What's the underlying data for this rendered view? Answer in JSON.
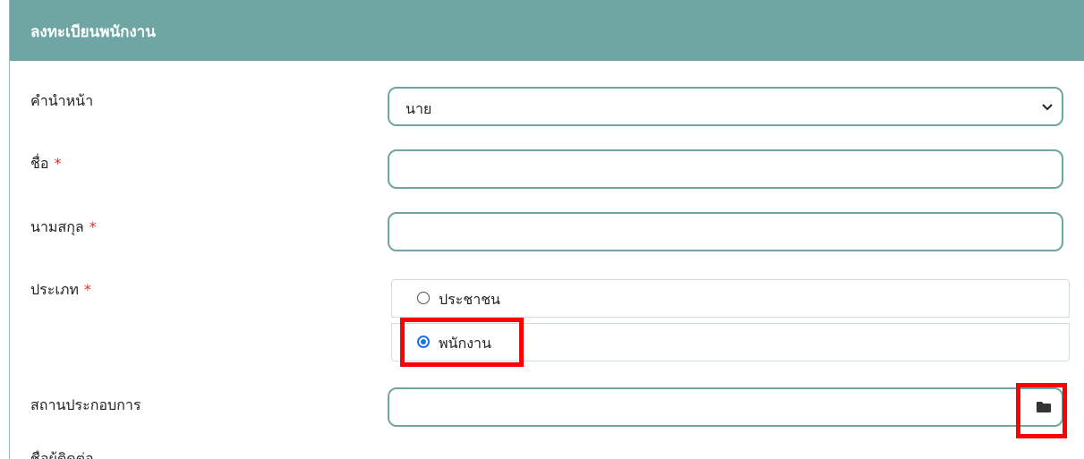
{
  "form": {
    "title": "ลงทะเบียนพนักงาน",
    "required_mark": "*",
    "prefix": {
      "label": "คำนำหน้า",
      "selected": "นาย"
    },
    "first_name": {
      "label": "ชื่อ",
      "value": ""
    },
    "last_name": {
      "label": "นามสกุล",
      "value": ""
    },
    "type": {
      "label": "ประเภท",
      "options": [
        {
          "label": "ประชาชน",
          "checked": false
        },
        {
          "label": "พนักงาน",
          "checked": true
        }
      ]
    },
    "establishment": {
      "label": "สถานประกอบการ",
      "value": "",
      "browse_icon": "folder-icon"
    },
    "next_label_partial": "ชื่อผู้ติดต่อ"
  },
  "colors": {
    "header_bg": "#6fa5a3",
    "field_border": "#6fa5a3",
    "required": "#d9312f",
    "highlight": "#ff0000",
    "radio_checked": "#1a73e8"
  }
}
